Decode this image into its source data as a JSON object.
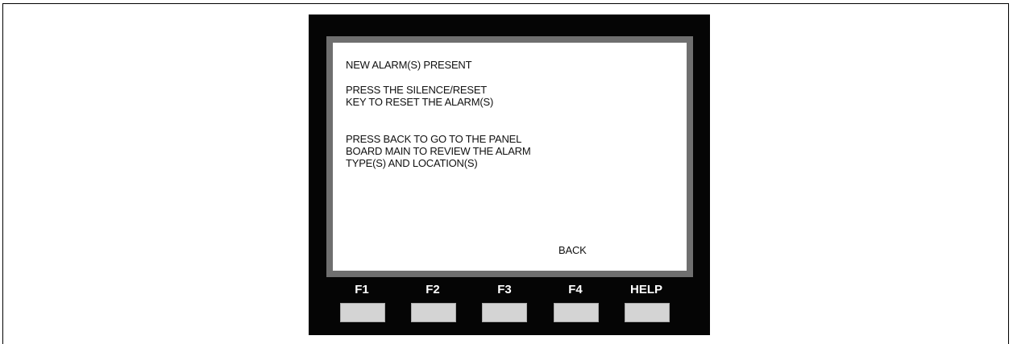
{
  "screen": {
    "lines": [
      "NEW ALARM(S) PRESENT",
      "PRESS THE SILENCE/RESET",
      "KEY TO RESET THE ALARM(S)",
      "PRESS BACK TO GO TO THE PANEL",
      "BOARD MAIN TO REVIEW THE ALARM",
      "TYPE(S) AND LOCATION(S)"
    ],
    "back_label": "BACK"
  },
  "softkeys": [
    {
      "label": "F1"
    },
    {
      "label": "F2"
    },
    {
      "label": "F3"
    },
    {
      "label": "F4"
    },
    {
      "label": "HELP"
    }
  ],
  "colors": {
    "device_body": "#050505",
    "bezel": "#6f6f6f",
    "screen": "#ffffff",
    "softkey_button": "#d4d4d4"
  }
}
